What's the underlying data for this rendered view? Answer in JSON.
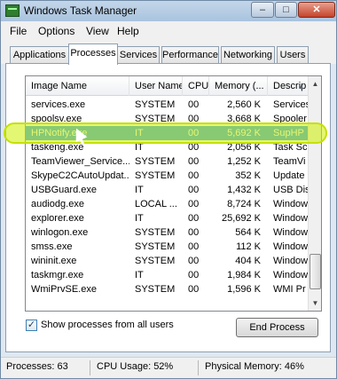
{
  "window": {
    "title": "Windows Task Manager",
    "minimize": "–",
    "maximize": "□",
    "close": "✕"
  },
  "menu": [
    "File",
    "Options",
    "View",
    "Help"
  ],
  "tabs": [
    "Applications",
    "Processes",
    "Services",
    "Performance",
    "Networking",
    "Users"
  ],
  "active_tab": "Processes",
  "columns": [
    "Image Name",
    "User Name",
    "CPU",
    "Memory (...",
    "Descrip"
  ],
  "rows": [
    {
      "name": "services.exe",
      "user": "SYSTEM",
      "cpu": "00",
      "mem": "2,560 K",
      "desc": "Services"
    },
    {
      "name": "spoolsv.exe",
      "user": "SYSTEM",
      "cpu": "00",
      "mem": "3,668 K",
      "desc": "Spooler"
    },
    {
      "name": "HPNotify.exe",
      "user": "IT",
      "cpu": "00",
      "mem": "5,692 K",
      "desc": "SupHP"
    },
    {
      "name": "taskeng.exe",
      "user": "IT",
      "cpu": "00",
      "mem": "2,056 K",
      "desc": "Task Sc"
    },
    {
      "name": "TeamViewer_Service....",
      "user": "SYSTEM",
      "cpu": "00",
      "mem": "1,252 K",
      "desc": "TeamVi"
    },
    {
      "name": "SkypeC2CAutoUpdat...",
      "user": "SYSTEM",
      "cpu": "00",
      "mem": "352 K",
      "desc": "Update"
    },
    {
      "name": "USBGuard.exe",
      "user": "IT",
      "cpu": "00",
      "mem": "1,432 K",
      "desc": "USB Dis"
    },
    {
      "name": "audiodg.exe",
      "user": "LOCAL ...",
      "cpu": "00",
      "mem": "8,724 K",
      "desc": "Window"
    },
    {
      "name": "explorer.exe",
      "user": "IT",
      "cpu": "00",
      "mem": "25,692 K",
      "desc": "Window"
    },
    {
      "name": "winlogon.exe",
      "user": "SYSTEM",
      "cpu": "00",
      "mem": "564 K",
      "desc": "Window"
    },
    {
      "name": "smss.exe",
      "user": "SYSTEM",
      "cpu": "00",
      "mem": "112 K",
      "desc": "Window"
    },
    {
      "name": "wininit.exe",
      "user": "SYSTEM",
      "cpu": "00",
      "mem": "404 K",
      "desc": "Window"
    },
    {
      "name": "taskmgr.exe",
      "user": "IT",
      "cpu": "00",
      "mem": "1,984 K",
      "desc": "Window"
    },
    {
      "name": "WmiPrvSE.exe",
      "user": "SYSTEM",
      "cpu": "00",
      "mem": "1,596 K",
      "desc": "WMI Pr"
    }
  ],
  "selected_row": "HPNotify.exe",
  "show_all_users": {
    "checked": true,
    "label": "Show processes from all users",
    "mark": "✓"
  },
  "end_process": "End Process",
  "status": {
    "processes": "Processes: 63",
    "cpu": "CPU Usage: 52%",
    "memory": "Physical Memory: 46%"
  }
}
